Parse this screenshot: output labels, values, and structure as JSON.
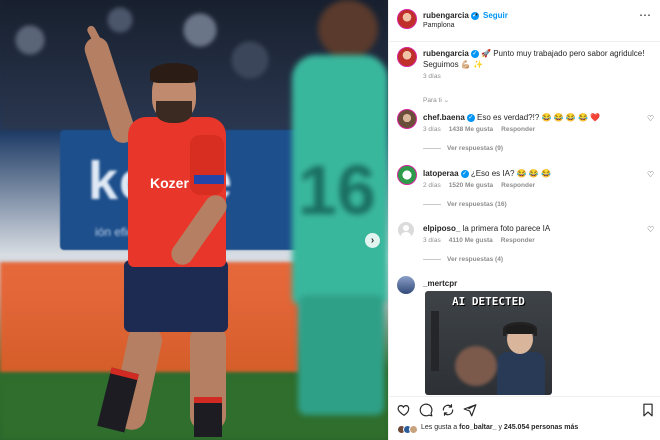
{
  "header": {
    "username": "rubengarcia",
    "separator": "•",
    "follow_label": "Seguir",
    "location": "Pamplona",
    "more_icon": "more-horizontal-icon"
  },
  "caption": {
    "username": "rubengarcia",
    "text": "🚀 Punto muy trabajado pero sabor agridulce! Seguimos 💪🏼 ✨",
    "time": "3 días"
  },
  "sort_label": "Para ti ⌄",
  "comments": [
    {
      "username": "chef.baena",
      "text": "Eso es verdad?!? 😂 😂 😂 😂 ❤️",
      "time": "3 días",
      "likes": "1438 Me gusta",
      "reply": "Responder",
      "view_replies": "Ver respuestas (9)"
    },
    {
      "username": "latoperaa",
      "text": "¿Eso es IA? 😂 😂 😂",
      "time": "2 días",
      "likes": "1520 Me gusta",
      "reply": "Responder",
      "view_replies": "Ver respuestas (16)"
    },
    {
      "username": "elpiposo_",
      "text": "la primera foto parece IA",
      "time": "3 días",
      "likes": "4110 Me gusta",
      "reply": "Responder",
      "view_replies": "Ver respuestas (4)"
    },
    {
      "username": "_mertcpr",
      "gif_text": "AI DETECTED"
    }
  ],
  "photo": {
    "board_text": "kome",
    "board_sub": "ión eficien",
    "sponsor": "Kozer",
    "defender_number": "16"
  },
  "likes_line": {
    "prefix": "Les gusta a",
    "user": "fco_baltar_",
    "middle": "y",
    "count": "245.054 personas más"
  },
  "icons": {
    "like": "heart-icon",
    "comment": "comment-icon",
    "share": "share-icon",
    "save": "bookmark-icon"
  }
}
